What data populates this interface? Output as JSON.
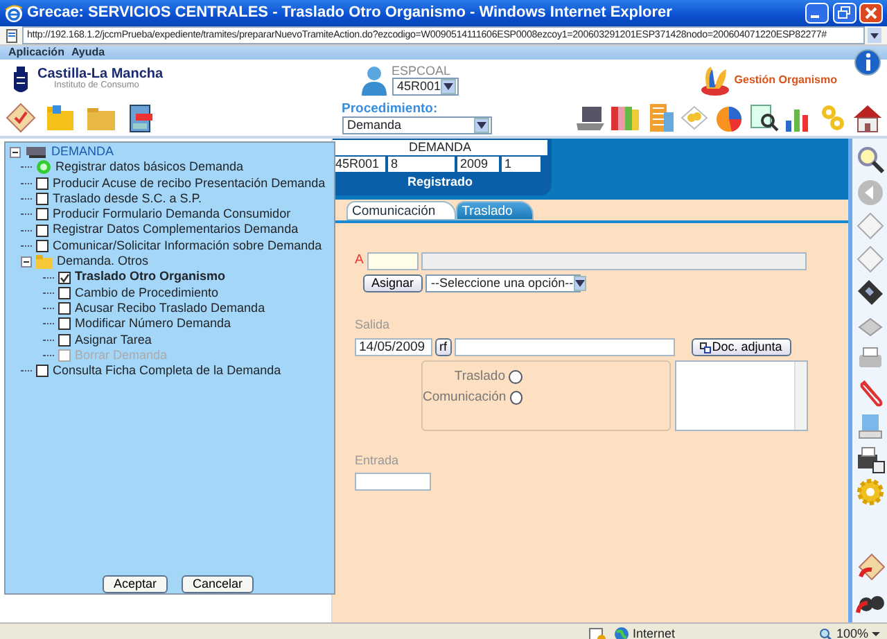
{
  "window": {
    "title": "Grecae: SERVICIOS CENTRALES - Traslado Otro Organismo - Windows Internet Explorer"
  },
  "address": {
    "url": "http://192.168.1.2/jccmPrueba/expediente/tramites/prepararNuevoTramiteAction.do?ezcodigo=W0090514111606ESP0008ezcoy1=200603291201ESP371428nodo=200604071220ESP82277#"
  },
  "menu": [
    "Aplicación",
    "Ayuda"
  ],
  "header": {
    "logo_title": "Castilla-La Mancha",
    "logo_subtitle": "Instituto de Consumo",
    "user": "ESPCOAL",
    "office": "45R001",
    "module": "Gestión Organismo"
  },
  "procedure": {
    "label": "Procedimiento:",
    "value": "Demanda"
  },
  "record": {
    "title": "DEMANDA",
    "fields": [
      "45R001",
      "8",
      "2009",
      "1"
    ],
    "status": "Registrado"
  },
  "tabs": [
    {
      "label": "Comunicación",
      "selected": false
    },
    {
      "label": "Traslado",
      "selected": true
    }
  ],
  "form": {
    "a_label": "A",
    "assign_button": "Asignar",
    "assign_select": "--Seleccione una opción--",
    "salida_label": "Salida",
    "date": "14/05/2009",
    "rf_button": "rf",
    "doc_button": "Doc. adjunta",
    "radios": [
      {
        "label": "Traslado",
        "selected": false
      },
      {
        "label": "Comunicación",
        "selected": false
      }
    ],
    "entrada_label": "Entrada"
  },
  "tree": {
    "label": "DEMANDA",
    "expanded": true,
    "children": [
      {
        "kind": "status",
        "label": "Registrar datos básicos Demanda"
      },
      {
        "kind": "task",
        "label": "Producir Acuse de recibo Presentación Demanda",
        "checked": false,
        "disabled": false
      },
      {
        "kind": "task",
        "label": "Traslado desde S.C. a S.P.",
        "checked": false,
        "disabled": false
      },
      {
        "kind": "task",
        "label": "Producir Formulario Demanda Consumidor",
        "checked": false,
        "disabled": false
      },
      {
        "kind": "task",
        "label": "Registrar Datos Complementarios Demanda",
        "checked": false,
        "disabled": false
      },
      {
        "kind": "task",
        "label": "Comunicar/Solicitar Información sobre Demanda",
        "checked": false,
        "disabled": false
      },
      {
        "kind": "folder",
        "label": "Demanda. Otros",
        "expanded": true,
        "children": [
          {
            "kind": "task",
            "label": "Traslado Otro Organismo",
            "checked": true,
            "disabled": false
          },
          {
            "kind": "task",
            "label": "Cambio de Procedimiento",
            "checked": false,
            "disabled": false
          },
          {
            "kind": "task",
            "label": "Acusar Recibo Traslado Demanda",
            "checked": false,
            "disabled": false
          },
          {
            "kind": "task",
            "label": "Modificar Número Demanda",
            "checked": false,
            "disabled": false
          },
          {
            "kind": "task",
            "label": "Asignar Tarea",
            "checked": false,
            "disabled": false
          },
          {
            "kind": "task",
            "label": "Borrar Demanda",
            "checked": false,
            "disabled": true
          }
        ]
      },
      {
        "kind": "task",
        "label": "Consulta Ficha Completa de la Demanda",
        "checked": false,
        "disabled": false
      }
    ]
  },
  "dialog_buttons": [
    "Aceptar",
    "Cancelar"
  ],
  "status_bar": {
    "zone": "Internet",
    "zoom": "100%"
  }
}
